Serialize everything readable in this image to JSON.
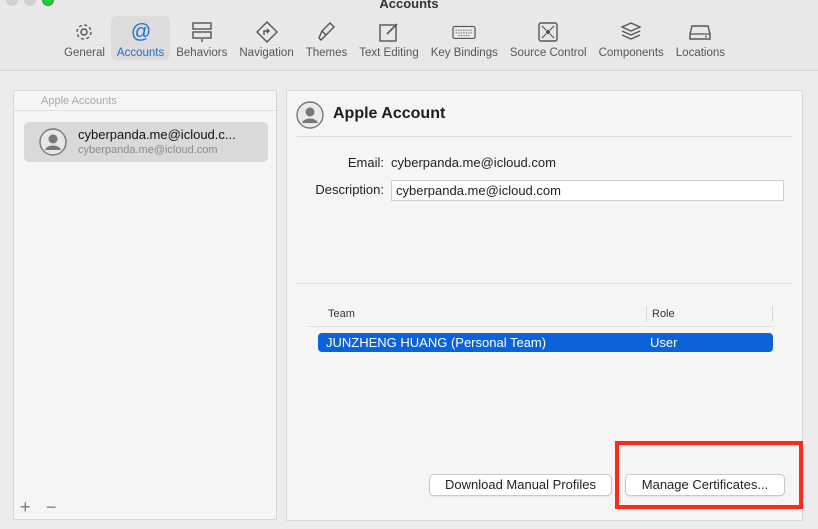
{
  "window": {
    "title": "Accounts"
  },
  "toolbar": {
    "items": [
      {
        "label": "General",
        "icon": "gear-icon"
      },
      {
        "label": "Accounts",
        "icon": "at-sign-icon",
        "active": true
      },
      {
        "label": "Behaviors",
        "icon": "behaviors-icon"
      },
      {
        "label": "Navigation",
        "icon": "navigation-icon"
      },
      {
        "label": "Themes",
        "icon": "paintbrush-icon"
      },
      {
        "label": "Text Editing",
        "icon": "pencil-square-icon"
      },
      {
        "label": "Key Bindings",
        "icon": "keyboard-icon"
      },
      {
        "label": "Source Control",
        "icon": "source-control-icon"
      },
      {
        "label": "Components",
        "icon": "stack-icon"
      },
      {
        "label": "Locations",
        "icon": "drive-icon"
      }
    ],
    "accent_color": "#1a6fd6"
  },
  "sidebar": {
    "header": "Apple Accounts",
    "accounts": [
      {
        "name": "cyberpanda.me@icloud.c...",
        "subtitle": "cyberpanda.me@icloud.com"
      }
    ],
    "add_symbol": "+",
    "remove_symbol": "−"
  },
  "detail": {
    "title": "Apple Account",
    "email_label": "Email:",
    "email_value": "cyberpanda.me@icloud.com",
    "description_label": "Description:",
    "description_value": "cyberpanda.me@icloud.com",
    "table": {
      "columns": [
        "Team",
        "Role"
      ],
      "rows": [
        {
          "team": "JUNZHENG HUANG (Personal Team)",
          "role": "User"
        }
      ],
      "selection_color": "#0a63d8"
    },
    "download_button": "Download Manual Profiles",
    "manage_button": "Manage Certificates...",
    "highlight_color": "#ff2a1c"
  }
}
